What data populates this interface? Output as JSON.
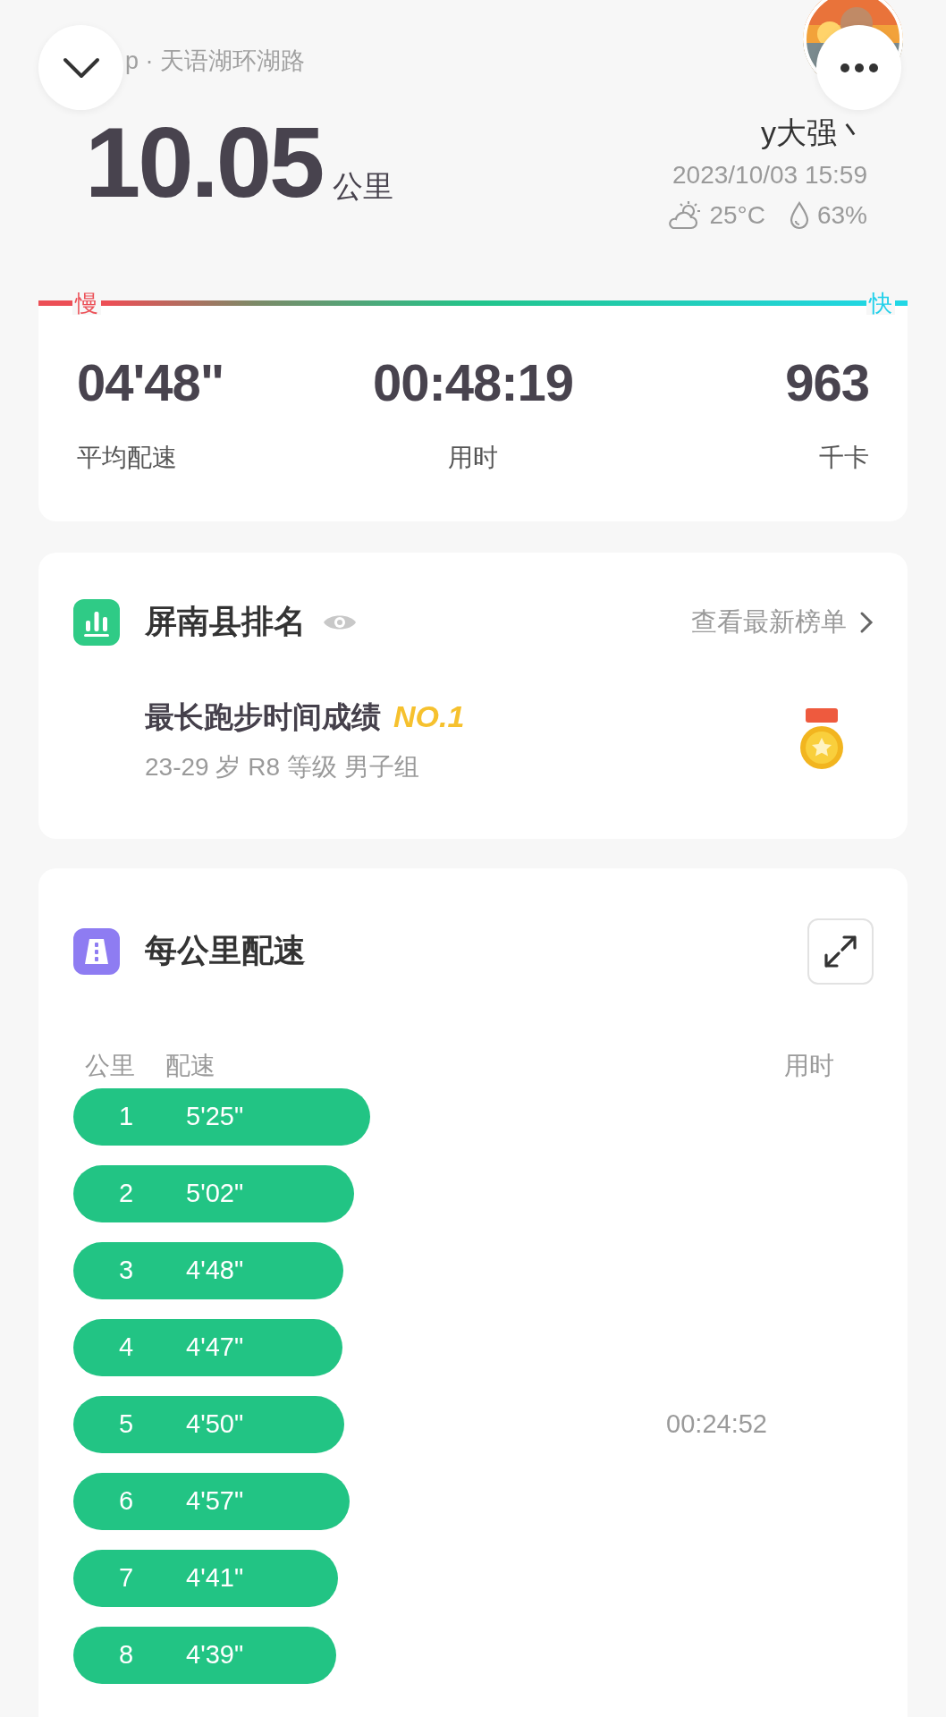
{
  "header": {
    "route": "p · 天语湖环湖路",
    "distance": "10.05",
    "distance_unit": "公里",
    "user_name": "y大强丶",
    "datetime": "2023/10/03 15:59",
    "temperature": "25°C",
    "humidity": "63%"
  },
  "summary": {
    "scale_slow": "慢",
    "scale_fast": "快",
    "stats": [
      {
        "value": "04'48\"",
        "label": "平均配速"
      },
      {
        "value": "00:48:19",
        "label": "用时"
      },
      {
        "value": "963",
        "label": "千卡"
      }
    ]
  },
  "ranking": {
    "title": "屏南县排名",
    "link": "查看最新榜单",
    "achievement": "最长跑步时间成绩",
    "rank": "NO.1",
    "group": "23-29 岁 R8 等级 男子组"
  },
  "pace": {
    "title": "每公里配速",
    "columns": [
      "公里",
      "配速",
      "用时"
    ],
    "splits": [
      {
        "km": "1",
        "pace": "5'25\""
      },
      {
        "km": "2",
        "pace": "5'02\""
      },
      {
        "km": "3",
        "pace": "4'48\""
      },
      {
        "km": "4",
        "pace": "4'47\""
      },
      {
        "km": "5",
        "pace": "4'50\"",
        "time": "00:24:52"
      },
      {
        "km": "6",
        "pace": "4'57\""
      },
      {
        "km": "7",
        "pace": "4'41\""
      },
      {
        "km": "8",
        "pace": "4'39\""
      }
    ]
  }
}
